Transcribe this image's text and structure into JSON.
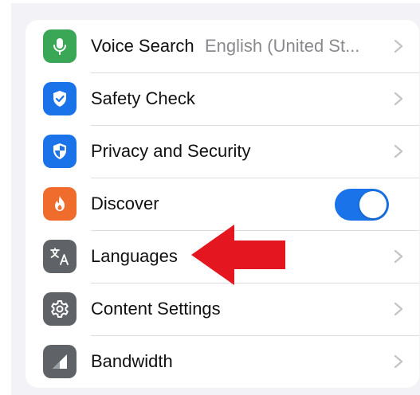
{
  "colors": {
    "voice_search_icon_bg": "#3aa757",
    "safety_check_icon_bg": "#1a73e8",
    "privacy_icon_bg": "#1a73e8",
    "discover_icon_bg": "#ef6c2d",
    "languages_icon_bg": "#5f6368",
    "content_settings_icon_bg": "#5f6368",
    "bandwidth_icon_bg": "#5f6368",
    "toggle_on": "#1a73e8",
    "annotation_arrow": "#e4161f"
  },
  "settings": {
    "voice_search": {
      "label": "Voice Search",
      "value": "English (United St...",
      "icon": "microphone-icon"
    },
    "safety_check": {
      "label": "Safety Check",
      "icon": "shield-check-icon"
    },
    "privacy_security": {
      "label": "Privacy and Security",
      "icon": "shield-icon"
    },
    "discover": {
      "label": "Discover",
      "icon": "flame-icon",
      "toggle_on": true
    },
    "languages": {
      "label": "Languages",
      "icon": "translate-icon"
    },
    "content_settings": {
      "label": "Content Settings",
      "icon": "gear-icon"
    },
    "bandwidth": {
      "label": "Bandwidth",
      "icon": "signal-icon"
    }
  },
  "annotation": {
    "type": "arrow",
    "points_to": "languages",
    "color": "#e4161f"
  }
}
